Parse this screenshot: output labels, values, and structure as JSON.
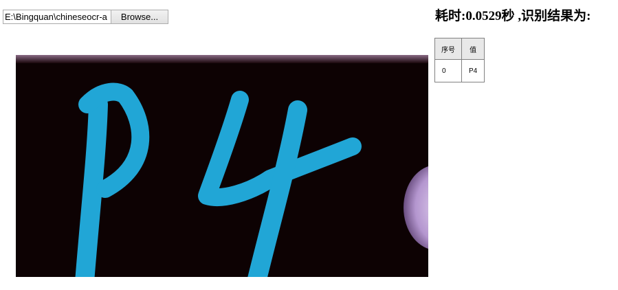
{
  "file_input": {
    "path_value": "E:\\Bingquan\\chineseocr-a",
    "browse_label": "Browse..."
  },
  "result": {
    "title": "耗时:0.0529秒 ,识别结果为:",
    "columns": [
      "序号",
      "值"
    ],
    "rows": [
      {
        "index": "0",
        "value": "P4"
      }
    ]
  },
  "image": {
    "content": "handwritten P4",
    "colors": {
      "background": "#0d0203",
      "stroke": "#21a6d6",
      "top_band": "#6b4a64",
      "corner_blob": "#c6aede"
    }
  }
}
